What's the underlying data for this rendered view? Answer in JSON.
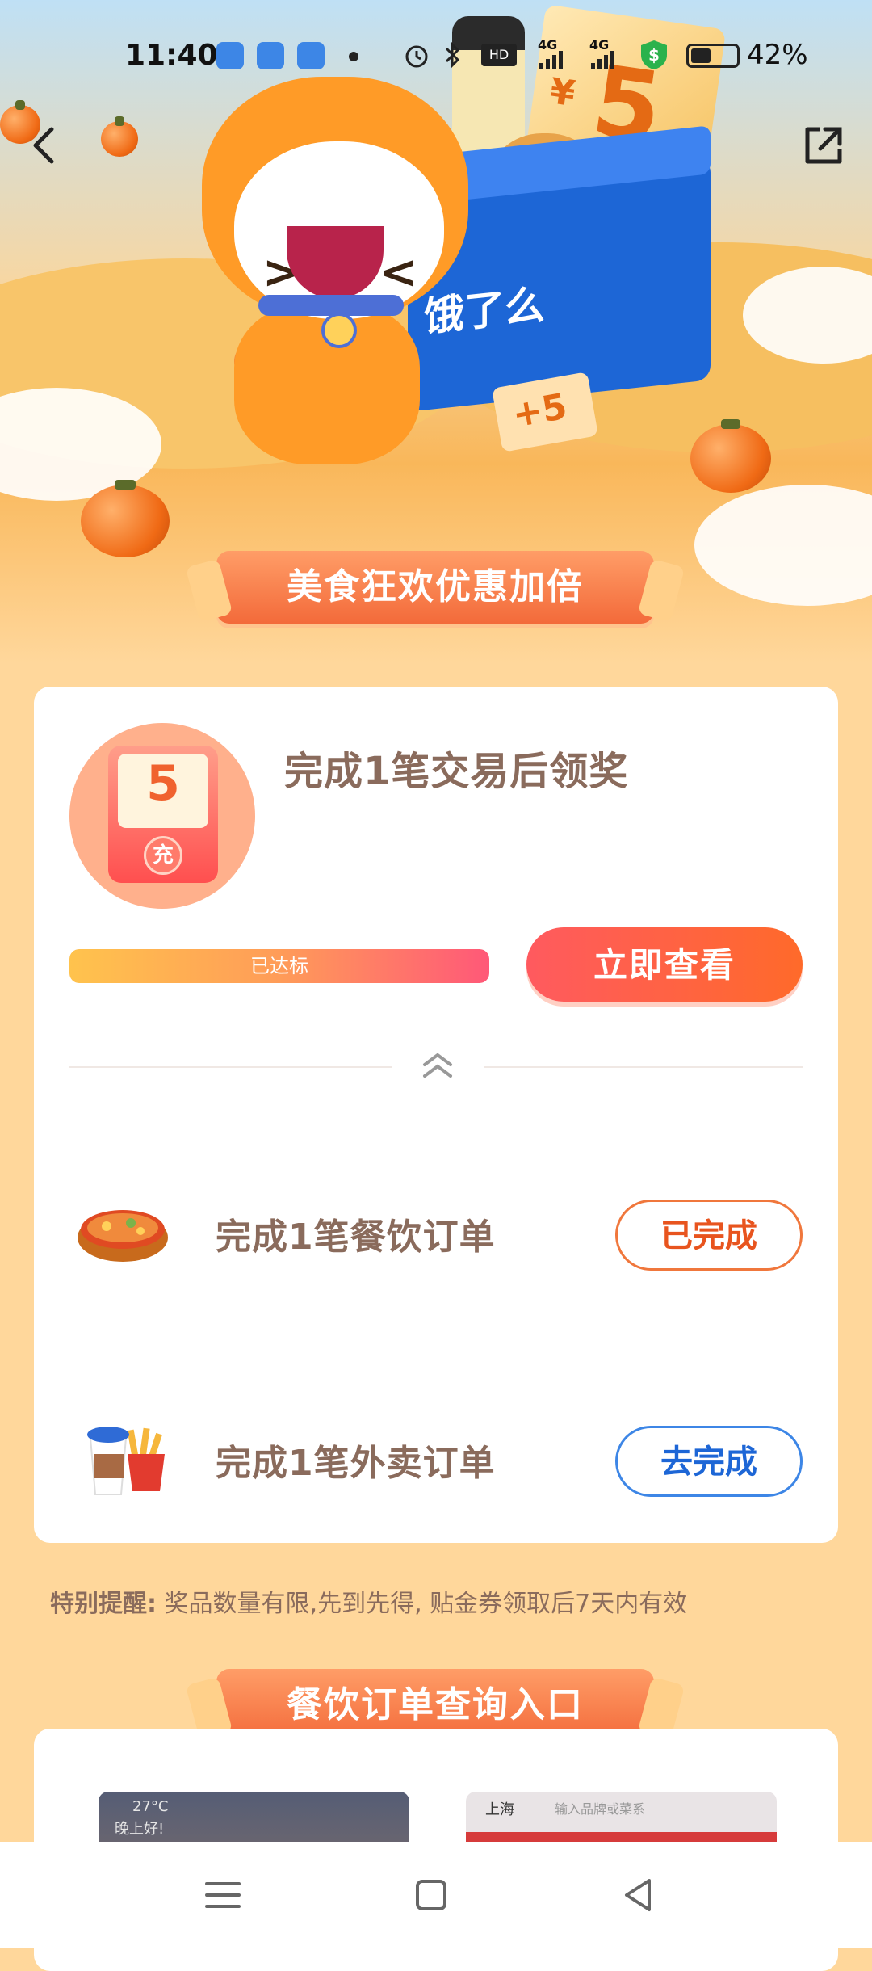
{
  "status_bar": {
    "time": "11:40",
    "battery": "42%",
    "network_labels": [
      "4G",
      "4G"
    ]
  },
  "hero": {
    "box_brand": "饿了么",
    "ticket_symbol": "¥",
    "ticket_amount": "5",
    "small_coupon": "+5",
    "ribbon_title": "美食狂欢优惠加倍"
  },
  "reward": {
    "coupon_amount": "5",
    "coupon_seal": "充",
    "title": "完成1笔交易后领奖",
    "progress_label": "已达标",
    "progress": 1.0,
    "view_button": "立即查看"
  },
  "tasks": [
    {
      "label": "完成1笔餐饮订单",
      "button": "已完成",
      "state": "done"
    },
    {
      "label": "完成1笔外卖订单",
      "button": "去完成",
      "state": "todo"
    }
  ],
  "reminder": {
    "prefix": "特别提醒:",
    "text": "奖品数量有限,先到先得, 贴金券领取后7天内有效"
  },
  "query_section": {
    "ribbon_title": "餐饮订单查询入口",
    "preview_left": {
      "temp": "27°C",
      "greeting": "晚上好!"
    },
    "preview_right": {
      "city": "上海",
      "search_placeholder": "输入品牌或菜系"
    }
  },
  "colors": {
    "accent_orange": "#ff6a2a",
    "accent_blue": "#1d66d6",
    "page_bg": "#ffd79b",
    "text_brown": "#8a6b5c"
  },
  "icons": [
    "back-icon",
    "share-icon",
    "collapse-up-icon",
    "menu-icon",
    "home-square-icon",
    "back-triangle-icon"
  ]
}
